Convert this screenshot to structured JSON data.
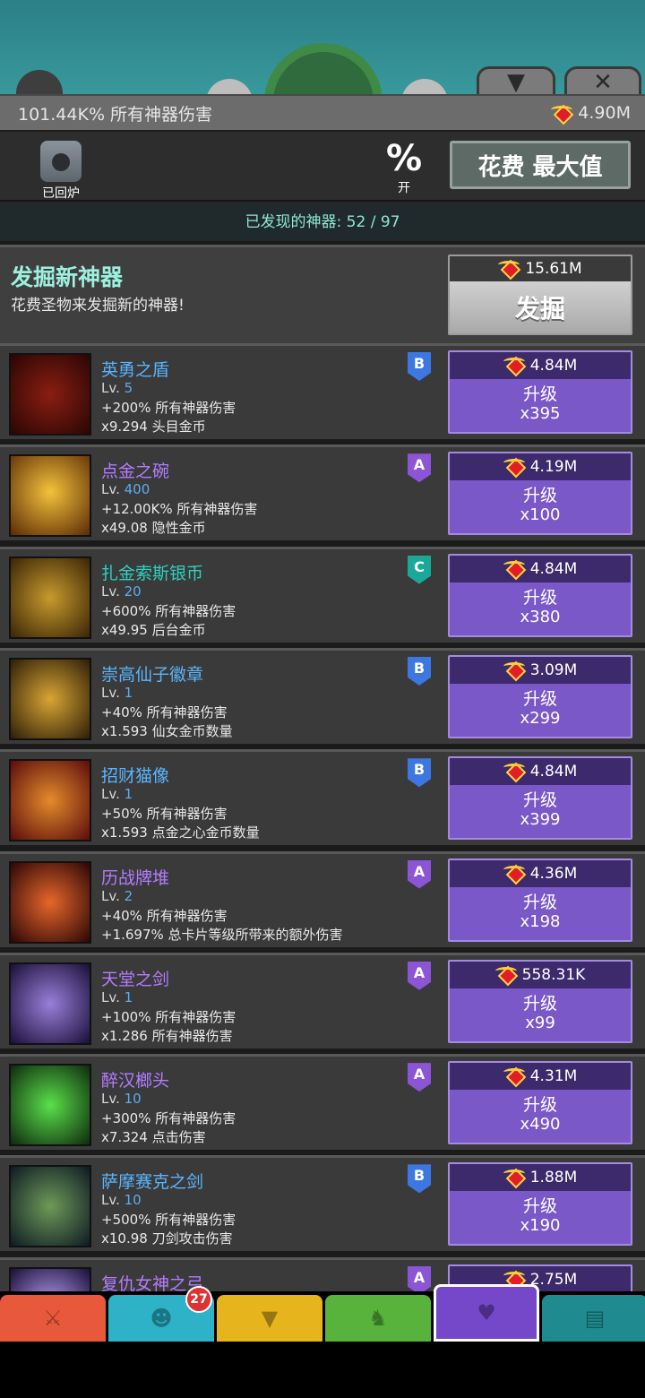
{
  "top_bar": {
    "damage_stat": "101.44K% 所有神器伤害",
    "relic_total": "4.90M",
    "collapse_icon": "chevron-down-icon",
    "close_icon": "close-icon"
  },
  "toolbar": {
    "reforged_label": "已回炉",
    "percent_symbol": "%",
    "percent_label": "开",
    "spend_button": "花费 最大值"
  },
  "found": {
    "text": "已发现的神器: 52 / 97"
  },
  "discover": {
    "title": "发掘新神器",
    "subtitle": "花费圣物来发掘新的神器!",
    "cost": "15.61M",
    "button": "发掘"
  },
  "artifacts": [
    {
      "name": "英勇之盾",
      "name_color": "#5ab4ff",
      "lv": "5",
      "effect1": "+200% 所有神器伤害",
      "effect2": "x9.294 头目金币",
      "tier": "B",
      "cost": "4.84M",
      "action": "升级",
      "mult": "x395",
      "icon": "shield-icon"
    },
    {
      "name": "点金之碗",
      "name_color": "#b37cff",
      "lv": "400",
      "effect1": "+12.00K% 所有神器伤害",
      "effect2": "x49.08 隐性金币",
      "tier": "A",
      "cost": "4.19M",
      "action": "升级",
      "mult": "x100",
      "icon": "gold-bowl-icon"
    },
    {
      "name": "扎金索斯银币",
      "name_color": "#2dd1bf",
      "lv": "20",
      "effect1": "+600% 所有神器伤害",
      "effect2": "x49.95 后台金币",
      "tier": "C",
      "cost": "4.84M",
      "action": "升级",
      "mult": "x380",
      "icon": "coin-icon"
    },
    {
      "name": "崇高仙子徽章",
      "name_color": "#5ab4ff",
      "lv": "1",
      "effect1": "+40% 所有神器伤害",
      "effect2": "x1.593 仙女金币数量",
      "tier": "B",
      "cost": "3.09M",
      "action": "升级",
      "mult": "x299",
      "icon": "fairy-badge-icon"
    },
    {
      "name": "招财猫像",
      "name_color": "#5ab4ff",
      "lv": "1",
      "effect1": "+50% 所有神器伤害",
      "effect2": "x1.593 点金之心金币数量",
      "tier": "B",
      "cost": "4.84M",
      "action": "升级",
      "mult": "x399",
      "icon": "lucky-cat-icon"
    },
    {
      "name": "历战牌堆",
      "name_color": "#b37cff",
      "lv": "2",
      "effect1": "+40% 所有神器伤害",
      "effect2": "+1.697% 总卡片等级所带来的额外伤害",
      "tier": "A",
      "cost": "4.36M",
      "action": "升级",
      "mult": "x198",
      "icon": "card-deck-icon"
    },
    {
      "name": "天堂之剑",
      "name_color": "#b37cff",
      "lv": "1",
      "effect1": "+100% 所有神器伤害",
      "effect2": "x1.286 所有神器伤害",
      "tier": "A",
      "cost": "558.31K",
      "action": "升级",
      "mult": "x99",
      "icon": "heaven-sword-icon"
    },
    {
      "name": "醉汉榔头",
      "name_color": "#b37cff",
      "lv": "10",
      "effect1": "+300% 所有神器伤害",
      "effect2": "x7.324 点击伤害",
      "tier": "A",
      "cost": "4.31M",
      "action": "升级",
      "mult": "x490",
      "icon": "hammer-icon"
    },
    {
      "name": "萨摩赛克之剑",
      "name_color": "#5ab4ff",
      "lv": "10",
      "effect1": "+500% 所有神器伤害",
      "effect2": "x10.98 刀剑攻击伤害",
      "tier": "B",
      "cost": "1.88M",
      "action": "升级",
      "mult": "x190",
      "icon": "sword-icon"
    },
    {
      "name": "复仇女神之弓",
      "name_color": "#b37cff",
      "lv": "",
      "effect1": "",
      "effect2": "",
      "tier": "A",
      "cost": "2.75M",
      "action": "",
      "mult": "",
      "icon": "bow-icon"
    }
  ],
  "nav": {
    "badge": "27",
    "tabs": [
      {
        "icon": "sword-icon",
        "color": "#e8583b"
      },
      {
        "icon": "heroes-icon",
        "color": "#2db2c8"
      },
      {
        "icon": "equipment-icon",
        "color": "#e6b41c"
      },
      {
        "icon": "pet-icon",
        "color": "#58b33c"
      },
      {
        "icon": "artifact-icon",
        "color": "#7448c9"
      },
      {
        "icon": "shop-icon",
        "color": "#1f8a8f"
      }
    ]
  }
}
